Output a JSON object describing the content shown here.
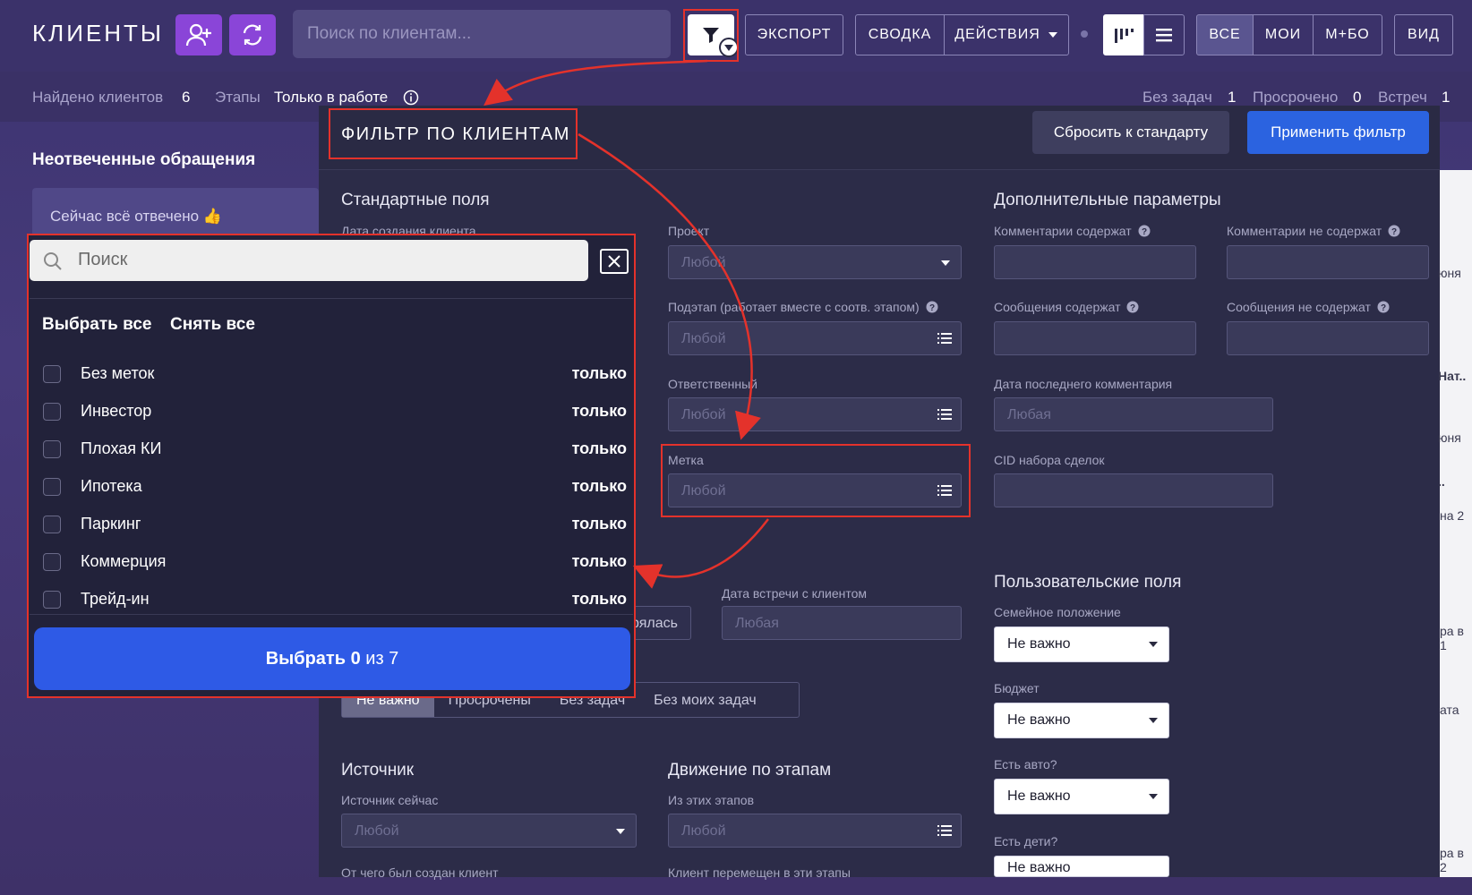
{
  "topbar": {
    "title": "КЛИЕНТЫ",
    "search_placeholder": "Поиск по клиентам...",
    "export_label": "ЭКСПОРТ",
    "summary_label": "СВОДКА",
    "actions_label": "ДЕЙСТВИЯ",
    "scope_tabs": [
      "ВСЕ",
      "МОИ",
      "М+БО"
    ],
    "view_label": "ВИД"
  },
  "subbar": {
    "found_label": "Найдено клиентов",
    "found_value": "6",
    "stages_label": "Этапы",
    "stages_value": "Только в работе",
    "no_tasks_label": "Без задач",
    "no_tasks_value": "1",
    "overdue_label": "Просрочено",
    "overdue_value": "0",
    "meetings_label": "Встреч",
    "meetings_value": "1"
  },
  "left": {
    "unanswered_title": "Неотвеченные обращения",
    "all_answered": "Сейчас всё отвечено 👍"
  },
  "filter": {
    "title": "ФИЛЬТР ПО КЛИЕНТАМ",
    "reset_label": "Сбросить к стандарту",
    "apply_label": "Применить фильтр",
    "standard_title": "Стандартные поля",
    "creation_date_label": "Дата создания клиента",
    "project_label": "Проект",
    "project_value": "Любой",
    "substage_label": "Подэтап (работает вместе с соотв. этапом)",
    "substage_value": "Любой",
    "responsible_label": "Ответственный",
    "responsible_value": "Любой",
    "tag_label": "Метка",
    "tag_value": "Любой",
    "meeting_tab_partial": "рялась",
    "meeting_date_label": "Дата встречи с клиентом",
    "meeting_date_value": "Любая",
    "task_tabs": [
      "Не важно",
      "Просрочены",
      "Без задач",
      "Без моих задач"
    ],
    "source_title": "Источник",
    "source_now_label": "Источник сейчас",
    "source_now_value": "Любой",
    "source_from_label": "От чего был создан клиент",
    "stages_title": "Движение по этапам",
    "from_stages_label": "Из этих этапов",
    "from_stages_value": "Любой",
    "moved_label": "Клиент перемещен в эти этапы",
    "extra_title": "Дополнительные параметры",
    "comments_contain_label": "Комментарии содержат",
    "comments_not_contain_label": "Комментарии не содержат",
    "messages_contain_label": "Сообщения содержат",
    "messages_not_contain_label": "Сообщения не содержат",
    "last_comment_label": "Дата последнего комментария",
    "last_comment_value": "Любая",
    "cid_label": "CID набора сделок",
    "custom_title": "Пользовательские поля",
    "family_label": "Семейное положение",
    "family_value": "Не важно",
    "budget_label": "Бюджет",
    "budget_value": "Не важно",
    "car_label": "Есть авто?",
    "car_value": "Не важно",
    "kids_label": "Есть дети?",
    "kids_value": "Не важно"
  },
  "popup": {
    "search_placeholder": "Поиск",
    "select_all": "Выбрать все",
    "deselect_all": "Снять все",
    "only_label": "только",
    "options": [
      "Без меток",
      "Инвестор",
      "Плохая КИ",
      "Ипотека",
      "Паркинг",
      "Коммерция",
      "Трейд-ин"
    ],
    "select_prefix": "Выбрать",
    "select_count": "0",
    "select_mid": "из",
    "select_total": "7"
  },
  "right_strip": [
    "юня",
    "Нат..",
    "юня",
    "..",
    "на 2",
    "ра в 1",
    "ата",
    "ра в 2"
  ],
  "colors": {
    "accent": "#2b63e0",
    "highlight": "#e4322b",
    "brand_button": "#8a45d8",
    "panel": "#2c2c48"
  }
}
